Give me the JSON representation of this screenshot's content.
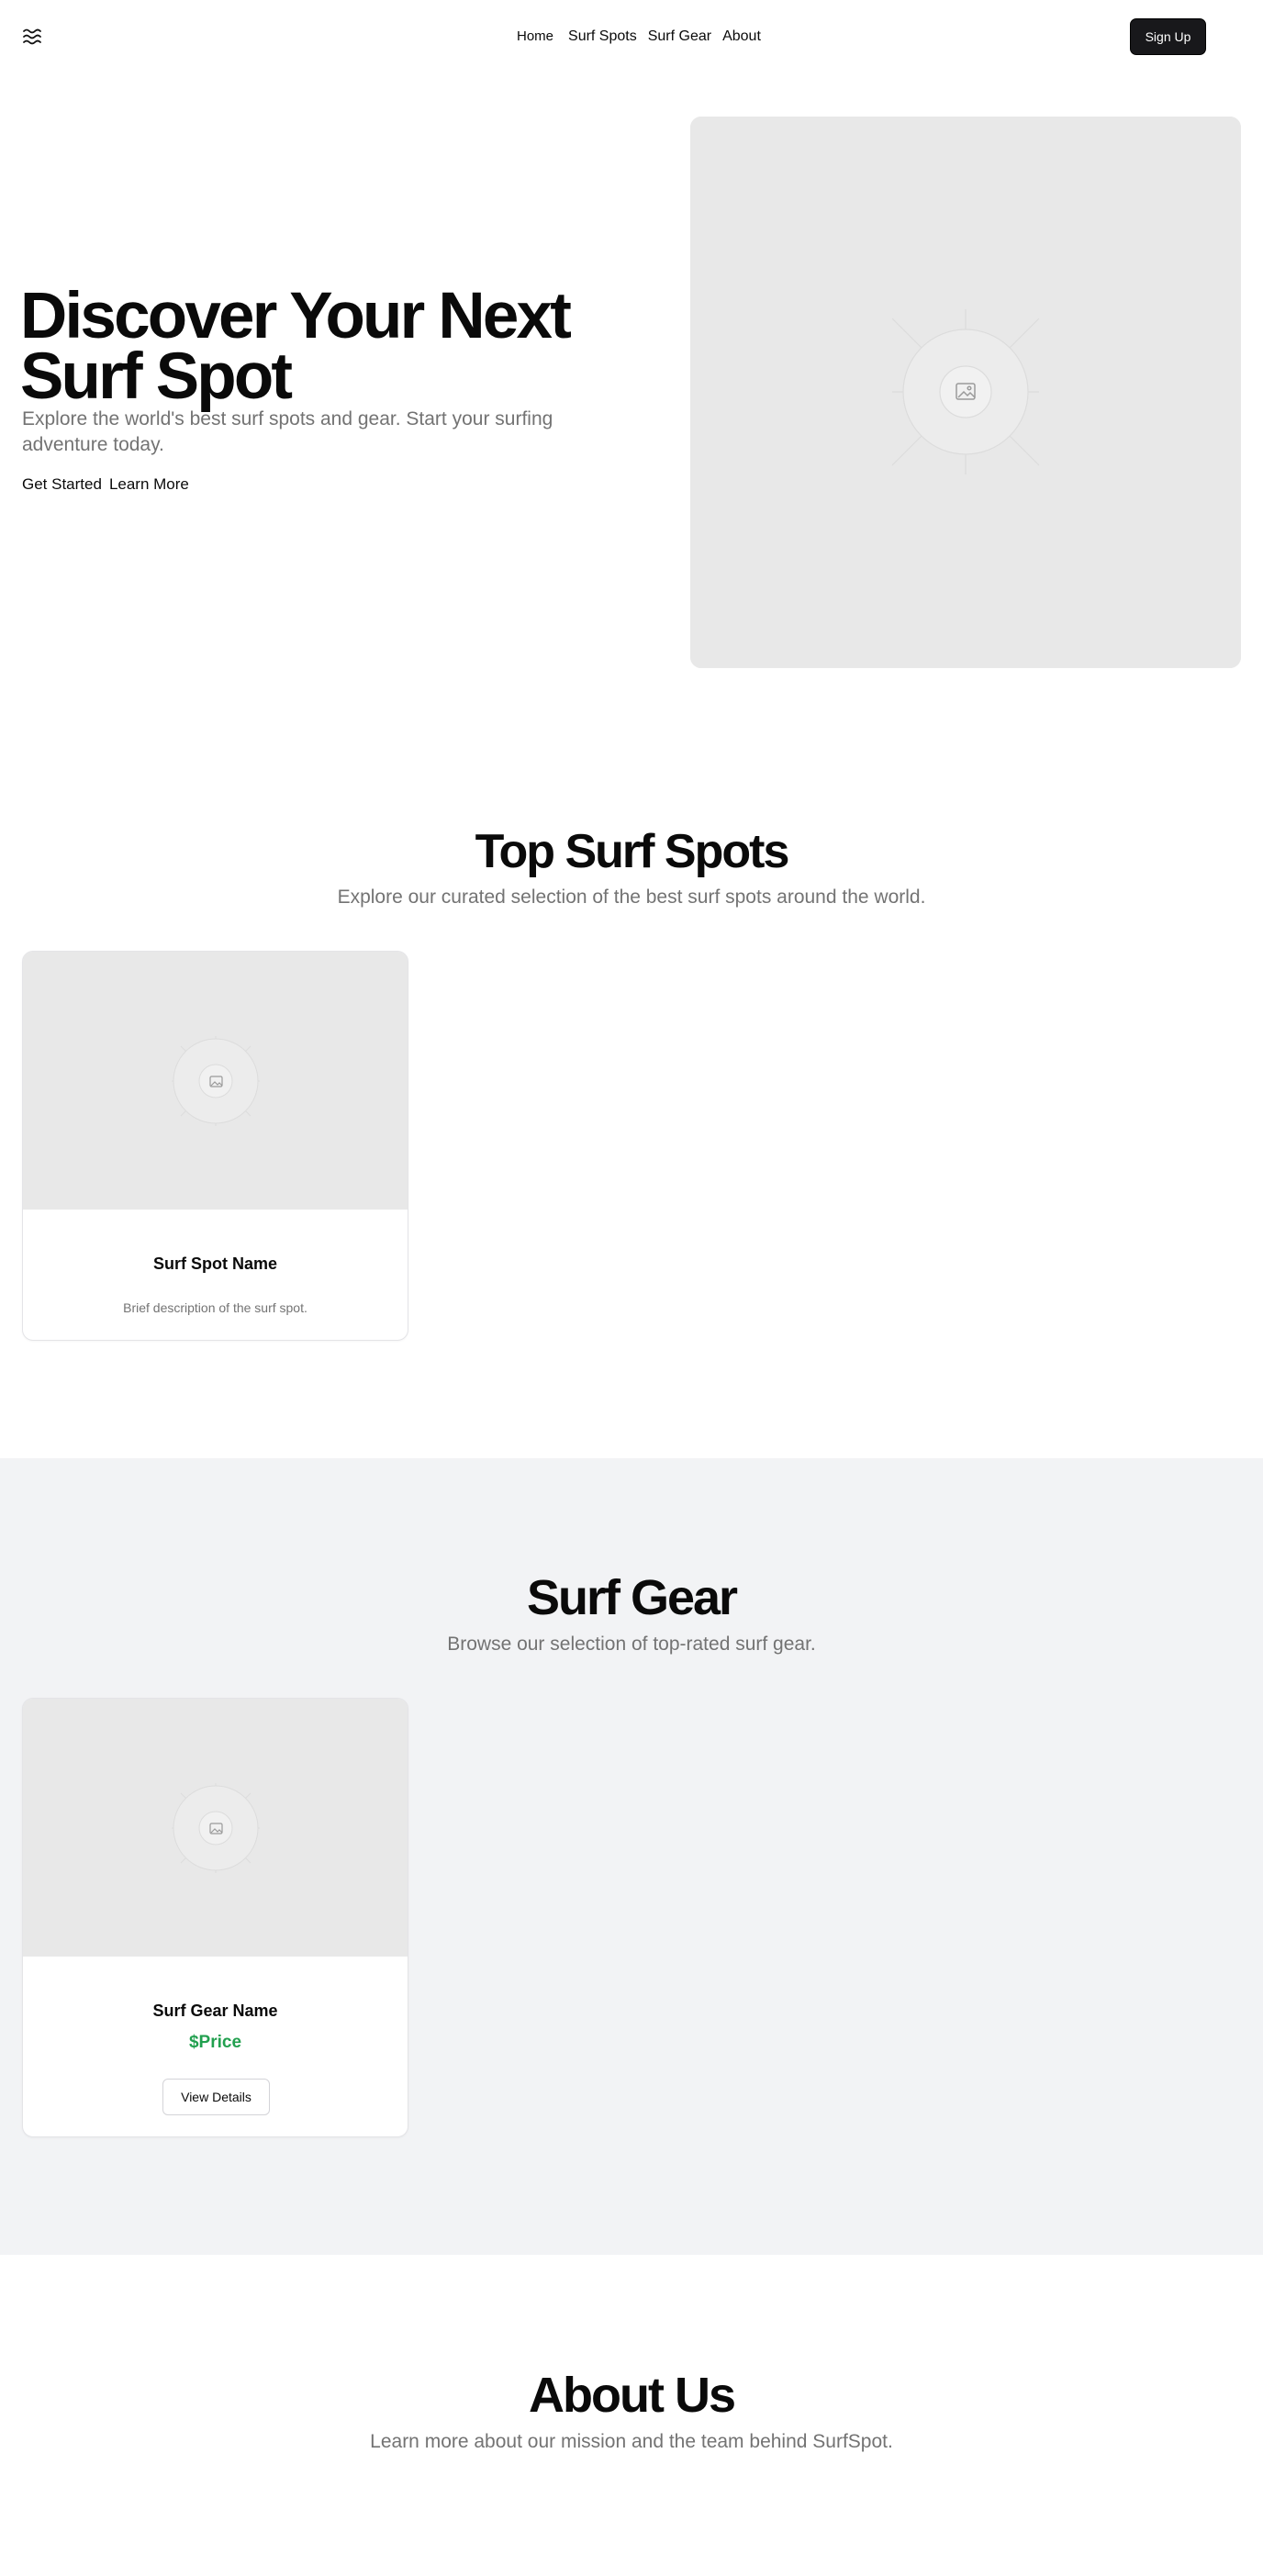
{
  "nav": {
    "logo_icon": "waves-icon",
    "links": [
      "Home",
      "Surf Spots",
      "Surf Gear",
      "About"
    ],
    "signup_label": "Sign Up"
  },
  "hero": {
    "title": "Discover Your Next Surf Spot",
    "subtitle": "Explore the world's best surf spots and gear. Start your surfing adventure today.",
    "primary_cta": "Get Started",
    "secondary_cta": "Learn More",
    "image_icon": "image-placeholder-icon"
  },
  "spots": {
    "title": "Top Surf Spots",
    "subtitle": "Explore our curated selection of the best surf spots around the world.",
    "cards": [
      {
        "name": "Surf Spot Name",
        "description": "Brief description of the surf spot."
      }
    ]
  },
  "gear": {
    "title": "Surf Gear",
    "subtitle": "Browse our selection of top-rated surf gear.",
    "cards": [
      {
        "name": "Surf Gear Name",
        "price": "$Price",
        "button_label": "View Details"
      }
    ]
  },
  "about": {
    "title": "About Us",
    "subtitle": "Learn more about our mission and the team behind SurfSpot."
  },
  "colors": {
    "primary_button": "#18181b",
    "price": "#22a04f",
    "muted_text": "#737373",
    "gear_background": "#f2f3f5",
    "placeholder": "#e8e8e8"
  }
}
